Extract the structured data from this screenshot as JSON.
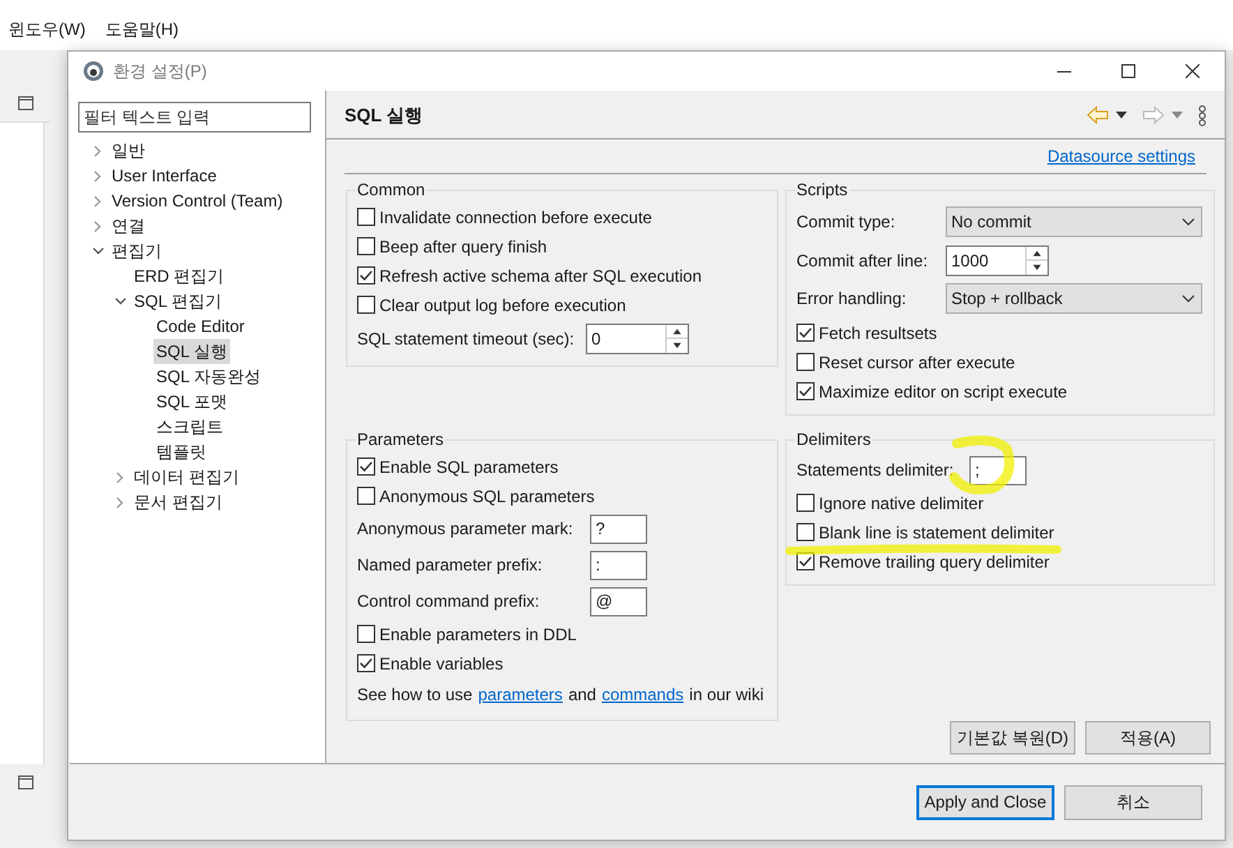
{
  "menu": [
    "윈도우(W)",
    "도움말(H)"
  ],
  "dialog": {
    "title": "환경 설정(P)",
    "filter": {
      "placeholder": "필터 텍스트 입력"
    },
    "tree": [
      {
        "label": "일반",
        "expanded": false,
        "selected": false
      },
      {
        "label": "User Interface",
        "expanded": false,
        "selected": false
      },
      {
        "label": "Version Control (Team)",
        "expanded": false,
        "selected": false
      },
      {
        "label": "연결",
        "expanded": false,
        "selected": false
      },
      {
        "label": "편집기",
        "expanded": true,
        "selected": false,
        "children": [
          {
            "label": "ERD 편집기",
            "selected": false
          },
          {
            "label": "SQL 편집기",
            "expanded": true,
            "selected": false,
            "children": [
              {
                "label": "Code Editor",
                "selected": false
              },
              {
                "label": "SQL 실행",
                "selected": true
              },
              {
                "label": "SQL 자동완성",
                "selected": false
              },
              {
                "label": "SQL 포맷",
                "selected": false
              },
              {
                "label": "스크립트",
                "selected": false
              },
              {
                "label": "템플릿",
                "selected": false
              }
            ]
          },
          {
            "label": "데이터 편집기",
            "expanded": false,
            "selected": false
          },
          {
            "label": "문서 편집기",
            "expanded": false,
            "selected": false
          }
        ]
      }
    ],
    "page_title": "SQL 실행",
    "link": "Datasource settings",
    "common": {
      "title": "Common",
      "rows": [
        {
          "kind": "checkbox",
          "label": "Invalidate connection before execute",
          "checked": false
        },
        {
          "kind": "checkbox",
          "label": "Beep after query finish",
          "checked": false
        },
        {
          "kind": "checkbox",
          "label": "Refresh active schema after SQL execution",
          "checked": true
        },
        {
          "kind": "checkbox",
          "label": "Clear output log before execution",
          "checked": false
        },
        {
          "kind": "spinner",
          "label": "SQL statement timeout (sec):",
          "value": "0"
        }
      ]
    },
    "scripts": {
      "title": "Scripts",
      "rows": [
        {
          "kind": "select",
          "label": "Commit type:",
          "value": "No commit"
        },
        {
          "kind": "spinner",
          "label": "Commit after line:",
          "value": "1000"
        },
        {
          "kind": "select",
          "label": "Error handling:",
          "value": "Stop + rollback"
        },
        {
          "kind": "checkbox",
          "label": "Fetch resultsets",
          "checked": true
        },
        {
          "kind": "checkbox",
          "label": "Reset cursor after execute",
          "checked": false
        },
        {
          "kind": "checkbox",
          "label": "Maximize editor on script execute",
          "checked": true
        }
      ]
    },
    "parameters": {
      "title": "Parameters",
      "rows": [
        {
          "kind": "checkbox",
          "label": "Enable SQL parameters",
          "checked": true
        },
        {
          "kind": "checkbox",
          "label": "Anonymous SQL parameters",
          "checked": false
        },
        {
          "kind": "text",
          "label": "Anonymous parameter mark:",
          "value": "?"
        },
        {
          "kind": "text",
          "label": "Named parameter prefix:",
          "value": ":"
        },
        {
          "kind": "text",
          "label": "Control command prefix:",
          "value": "@"
        },
        {
          "kind": "checkbox",
          "label": "Enable parameters in DDL",
          "checked": false
        },
        {
          "kind": "checkbox",
          "label": "Enable variables",
          "checked": true
        },
        {
          "kind": "note",
          "parts": [
            {
              "text": "See how to use",
              "link": false
            },
            {
              "text": "parameters",
              "link": true
            },
            {
              "text": "and",
              "link": false
            },
            {
              "text": "commands",
              "link": true
            },
            {
              "text": "in our wiki",
              "link": false
            }
          ]
        }
      ]
    },
    "delimiters": {
      "title": "Delimiters",
      "rows": [
        {
          "kind": "text",
          "label": "Statements delimiter:",
          "value": ";"
        },
        {
          "kind": "checkbox",
          "label": "Ignore native delimiter",
          "checked": false
        },
        {
          "kind": "checkbox",
          "label": "Blank line is statement delimiter",
          "checked": false
        },
        {
          "kind": "checkbox",
          "label": "Remove trailing query delimiter",
          "checked": true
        }
      ]
    },
    "page_buttons": [
      "기본값 복원(D)",
      "적용(A)"
    ],
    "footer_buttons": [
      {
        "label": "Apply and Close",
        "default": true
      },
      {
        "label": "취소",
        "default": false
      }
    ]
  }
}
